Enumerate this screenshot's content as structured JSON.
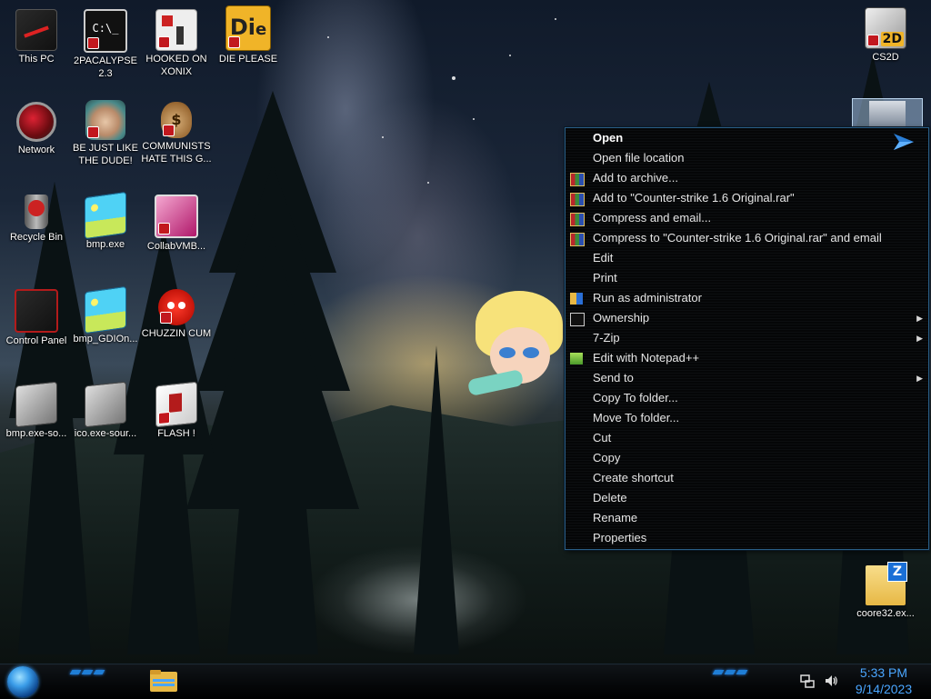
{
  "desktop": {
    "icons": [
      {
        "label": "This PC"
      },
      {
        "label": "2PACALYPSE 2.3"
      },
      {
        "label": "HOOKED ON XONIX"
      },
      {
        "label": "DIE PLEASE"
      },
      {
        "label": "Network"
      },
      {
        "label": "BE JUST LIKE THE DUDE!"
      },
      {
        "label": "COMMUNISTS HATE THIS G..."
      },
      {
        "label": "Recycle Bin"
      },
      {
        "label": "bmp.exe"
      },
      {
        "label": "CollabVMB..."
      },
      {
        "label": "Control Panel"
      },
      {
        "label": "bmp_GDIOn..."
      },
      {
        "label": "CHUZZIN CUM"
      },
      {
        "label": "bmp.exe-so..."
      },
      {
        "label": "ico.exe-sour..."
      },
      {
        "label": "FLASH !"
      },
      {
        "label": "CS2D"
      },
      {
        "label": "coore32.ex..."
      }
    ]
  },
  "context_menu": {
    "items": [
      {
        "label": "Open",
        "bold": true
      },
      {
        "label": "Open file location"
      },
      {
        "label": "Add to archive..."
      },
      {
        "label": "Add to \"Counter-strike 1.6 Original.rar\""
      },
      {
        "label": "Compress and email..."
      },
      {
        "label": "Compress to \"Counter-strike 1.6 Original.rar\" and email"
      },
      {
        "label": "Edit"
      },
      {
        "label": "Print"
      },
      {
        "label": "Run as administrator"
      },
      {
        "label": "Ownership",
        "submenu": true
      },
      {
        "label": "7-Zip",
        "submenu": true
      },
      {
        "label": "Edit with Notepad++"
      },
      {
        "label": "Send to",
        "submenu": true
      },
      {
        "label": "Copy To folder..."
      },
      {
        "label": "Move To folder..."
      },
      {
        "label": "Cut"
      },
      {
        "label": "Copy"
      },
      {
        "label": "Create shortcut"
      },
      {
        "label": "Delete"
      },
      {
        "label": "Rename"
      },
      {
        "label": "Properties"
      }
    ]
  },
  "taskbar": {
    "time": "5:33 PM",
    "date": "9/14/2023"
  },
  "colors": {
    "menu_border": "#2a5e86",
    "clock": "#4aa6ff",
    "winrar_red": "#b8262a"
  }
}
